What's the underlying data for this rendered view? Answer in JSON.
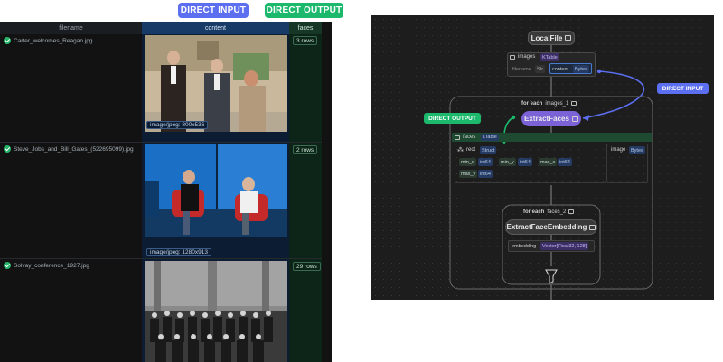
{
  "labels": {
    "direct_input": "DIRECT INPUT",
    "direct_output": "DIRECT OUTPUT"
  },
  "table": {
    "columns": [
      "filename",
      "content",
      "faces"
    ],
    "rows": [
      {
        "filename": "Carter_welcomes_Reagan.jpg",
        "content_tag": "image/jpeg: 800x536",
        "faces": "3 rows"
      },
      {
        "filename": "Steve_Jobs_and_Bill_Gates_(522695099).jpg",
        "content_tag": "image/jpeg: 1280x913",
        "faces": "2 rows"
      },
      {
        "filename": "Solvay_conference_1927.jpg",
        "content_tag": "",
        "faces": "29 rows"
      }
    ]
  },
  "graph": {
    "local_file": "LocalFile",
    "images_label": "images",
    "images_type": "KTable",
    "filename_label": "filename",
    "filename_type": "Str",
    "content_label": "content",
    "content_type": "Bytes",
    "for_each_1": "for each",
    "for_each_1_target": "images_1",
    "extract_faces": "ExtractFaces",
    "faces_label": "faces",
    "faces_type": "LTable",
    "rect_label": "rect",
    "rect_type": "Struct",
    "min_x": "min_x",
    "min_x_type": "int64",
    "min_y": "min_y",
    "min_y_type": "int64",
    "max_x": "max_x",
    "max_x_type": "int64",
    "max_y": "max_y",
    "max_y_type": "int64",
    "image_label": "image",
    "image_type": "Bytes",
    "for_each_2": "for each",
    "for_each_2_target": "faces_2",
    "extract_face_embedding": "ExtractFaceEmbedding",
    "embedding_label": "embedding",
    "embedding_type": "Vector[Float32, 128]"
  },
  "colors": {
    "direct_input": "#5b6ff0",
    "direct_output": "#1cb96c",
    "content_column": "#0b1c33",
    "faces_column": "#0d2418"
  }
}
